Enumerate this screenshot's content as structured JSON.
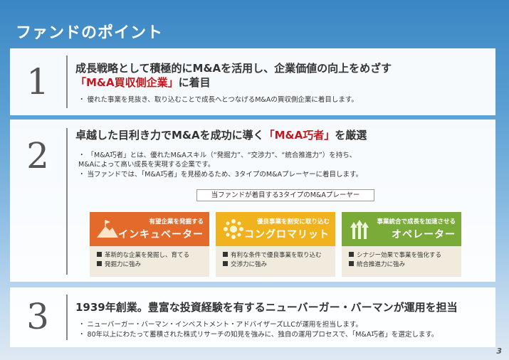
{
  "title": "ファンドのポイント",
  "points": [
    {
      "number": "1",
      "heading_line1": "成長戦略として積極的にM&Aを活用し、企業価値の向上をめざす",
      "heading_red": "「M&A買収側企業」",
      "heading_after": "に着目",
      "bullets": [
        "・ 優れた事業を見抜き、取り込むことで成長へとつなげるM&Aの買収側企業に着目します。"
      ]
    },
    {
      "number": "2",
      "heading_before": "卓越した目利き力でM&Aを成功に導く",
      "heading_red": "「M&A巧者」",
      "heading_after": "を厳選",
      "bullets": [
        "・ 「M&A巧者」とは、優れたM&Aスキル（“発掘力”、“交渉力”、“統合推進力”）を持ち、",
        "   M&Aによって高い成長を実現する企業です。",
        "・ 当ファンドでは、「M&A巧者」を見極めるため、3タイプのM&Aプレーヤーに着目します。"
      ],
      "player_label": "当ファンドが着目する3タイプのM&Aプレーヤー",
      "players": [
        {
          "sub": "有望企業を発掘する",
          "name": "インキュベーター",
          "color": "#e36a2a",
          "icon": "mountain-flag-icon",
          "items": [
            "革新的な企業を発掘し、育てる",
            "発掘力に強み"
          ]
        },
        {
          "sub": "優良事業を割安に取り込む",
          "name": "コングロマリット",
          "color": "#f1b31d",
          "icon": "sun-cluster-icon",
          "items": [
            "有利な条件で優良事業を取り込む",
            "交渉力に強み"
          ]
        },
        {
          "sub": "事業統合で成長を加速させる",
          "name": "オペレーター",
          "color": "#7aab38",
          "icon": "upward-arrows-icon",
          "items": [
            "シナジー効果で事業を強化する",
            "統合推進力に強み"
          ]
        }
      ]
    },
    {
      "number": "3",
      "heading": "1939年創業。豊富な投資経験を有するニューバーガー・バーマンが運用を担当",
      "bullets": [
        "・ ニューバーガー・バーマン・インベストメント・アドバイザーズLLCが運用を担当します。",
        "・ 80年以上にわたって蓄積された株式リサーチの知見を強みに、独自の運用プロセスで、「M&A巧者」を選定します。"
      ]
    }
  ],
  "page_number": "3"
}
